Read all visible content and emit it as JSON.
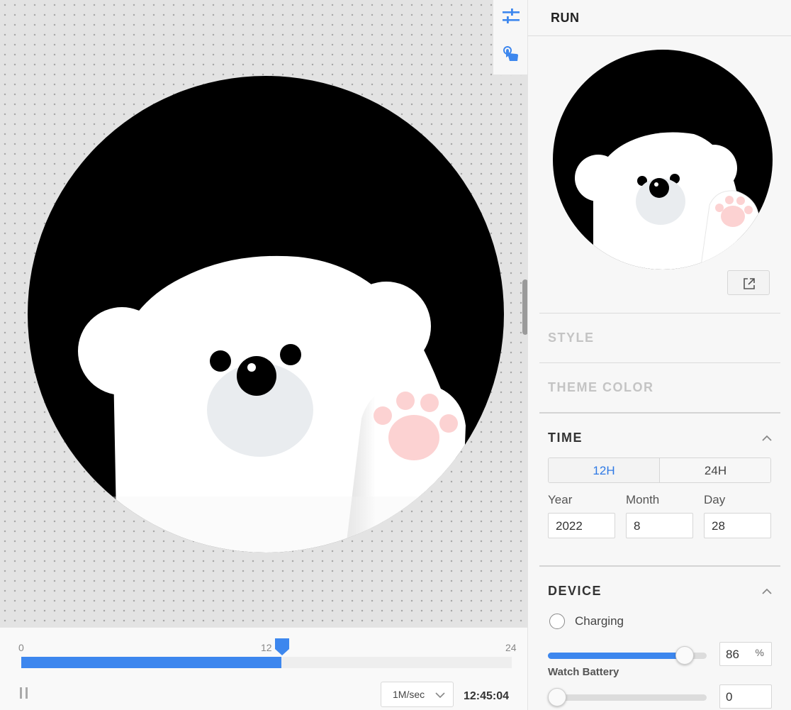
{
  "colors": {
    "accent": "#3d87ee",
    "face_black": "#000000",
    "bear_white": "#ffffff",
    "muzzle": "#e9ecef",
    "paw_pad": "#fcd2d2"
  },
  "canvas": {
    "tools": [
      {
        "icon": "sliders-icon"
      },
      {
        "icon": "touch-hand-icon"
      }
    ]
  },
  "timeline": {
    "ticks": [
      "0",
      "12",
      "24"
    ],
    "progress_fraction": 0.53,
    "speed": "1M/sec",
    "clock": "12:45:04"
  },
  "panel": {
    "title": "RUN",
    "open_icon": "open-external-icon",
    "sections": {
      "style": "STYLE",
      "theme_color": "THEME COLOR",
      "time": "TIME",
      "device": "DEVICE"
    },
    "time": {
      "format_options": [
        "12H",
        "24H"
      ],
      "selected_format": "12H",
      "year_label": "Year",
      "month_label": "Month",
      "day_label": "Day",
      "year": "2022",
      "month": "8",
      "day": "28"
    },
    "device": {
      "charging_label": "Charging",
      "battery_value": "86",
      "battery_unit": "%",
      "battery_label": "Watch Battery",
      "slider2_value": "0"
    }
  }
}
